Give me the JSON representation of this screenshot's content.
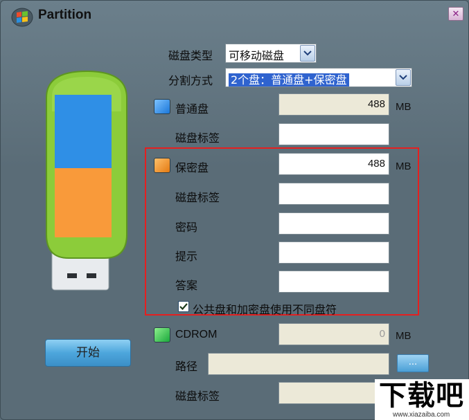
{
  "window": {
    "title": "Partition",
    "close_icon": "close-icon"
  },
  "form": {
    "disk_type": {
      "label": "磁盘类型",
      "value": "可移动磁盘"
    },
    "partition_mode": {
      "label": "分割方式",
      "value": "2个盘：普通盘+保密盘"
    },
    "normal_disk": {
      "label": "普通盘",
      "size": "488",
      "unit": "MB",
      "color": "#1b77d9",
      "tag_label": "磁盘标签",
      "tag_value": ""
    },
    "secret_disk": {
      "label": "保密盘",
      "size": "488",
      "unit": "MB",
      "color": "#e47a12",
      "tag_label": "磁盘标签",
      "tag_value": "",
      "password_label": "密码",
      "password_value": "",
      "hint_label": "提示",
      "hint_value": "",
      "answer_label": "答案",
      "answer_value": "",
      "different_letter_checkbox": {
        "label": "公共盘和加密盘使用不同盘符",
        "checked": true
      }
    },
    "cdrom": {
      "label": "CDROM",
      "size": "0",
      "unit": "MB",
      "color": "#1aa83c",
      "path_label": "路径",
      "path_value": "",
      "browse_label": "...",
      "tag_label": "磁盘标签",
      "tag_value": ""
    }
  },
  "start_button": "开始",
  "usb_illustration": {
    "body_color": "#8ccc3a",
    "top_color": "#2f8fe6",
    "bottom_color": "#f99a3a"
  },
  "watermark": {
    "main": "下载吧",
    "sub": "www.xiazaiba.com"
  },
  "accent": {
    "selection": "#2f63cf",
    "highlight_border": "#e51f1f"
  }
}
